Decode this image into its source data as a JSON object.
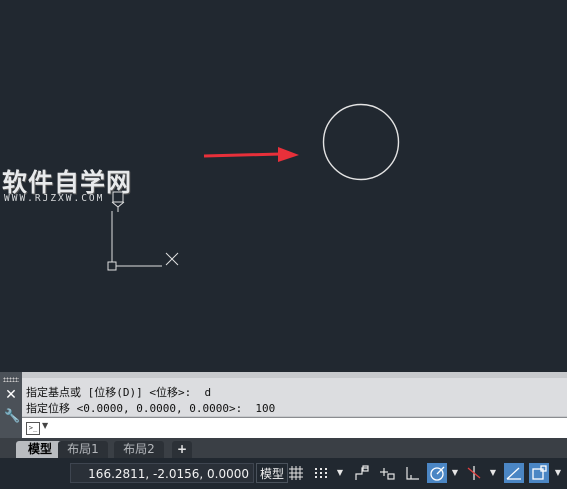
{
  "watermark": {
    "title": "软件自学网",
    "url": "WWW.RJZXW.COM"
  },
  "ucs": {
    "y_label": "Y",
    "x_label": "X"
  },
  "command": {
    "history": [
      "指定基点或 [位移(D)] <位移>:  d",
      "指定位移 <0.0000, 0.0000, 0.0000>:  100"
    ],
    "input_value": "",
    "prompt_icon": ">_"
  },
  "tabs": [
    {
      "label": "模型",
      "active": true
    },
    {
      "label": "布局1",
      "active": false
    },
    {
      "label": "布局2",
      "active": false
    }
  ],
  "add_tab_label": "+",
  "status": {
    "coordinates": "166.2811, -2.0156, 0.0000",
    "model_label": "模型"
  },
  "colors": {
    "canvas": "#212830",
    "arrow": "#e8303a",
    "accent": "#4b86c4"
  },
  "icons": {
    "grid": "grid-icon",
    "snap": "snap-icon",
    "infer": "infer-constraints-icon",
    "dynamic_input": "dynamic-input-icon",
    "ortho": "ortho-icon",
    "polar": "polar-tracking-icon",
    "osnap_tracking": "object-snap-tracking-icon",
    "lineweight": "lineweight-icon",
    "annotation": "annotation-icon"
  }
}
